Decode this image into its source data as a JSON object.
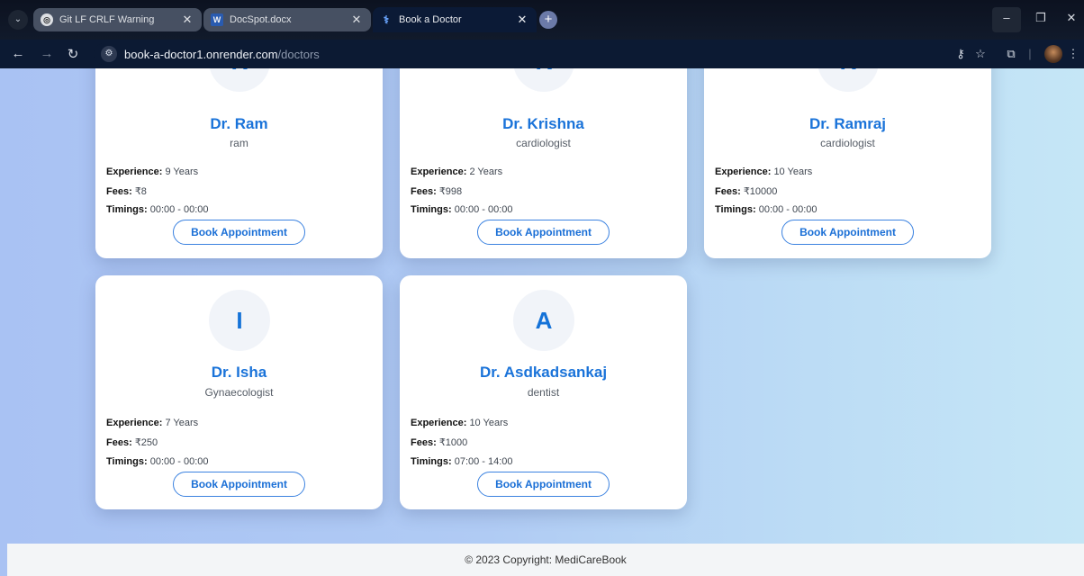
{
  "browser": {
    "tabs": [
      {
        "title": "Git LF CRLF Warning",
        "icon": "chatgpt-icon",
        "active": false
      },
      {
        "title": "DocSpot.docx",
        "icon": "word-icon",
        "active": false
      },
      {
        "title": "Book a Doctor",
        "icon": "stethoscope-icon",
        "active": true
      }
    ],
    "url_host": "book-a-doctor1.onrender.com",
    "url_path": "/doctors"
  },
  "doctors": [
    {
      "initial": "R",
      "name": "Dr. Ram",
      "specialization": "ram",
      "experience_label": "Experience:",
      "experience": "9 Years",
      "fees_label": "Fees:",
      "fees": "₹8",
      "timings_label": "Timings:",
      "timings": "00:00 - 00:00",
      "button": "Book Appointment"
    },
    {
      "initial": "K",
      "name": "Dr. Krishna",
      "specialization": "cardiologist",
      "experience_label": "Experience:",
      "experience": "2 Years",
      "fees_label": "Fees:",
      "fees": "₹998",
      "timings_label": "Timings:",
      "timings": "00:00 - 00:00",
      "button": "Book Appointment"
    },
    {
      "initial": "R",
      "name": "Dr. Ramraj",
      "specialization": "cardiologist",
      "experience_label": "Experience:",
      "experience": "10 Years",
      "fees_label": "Fees:",
      "fees": "₹10000",
      "timings_label": "Timings:",
      "timings": "00:00 - 00:00",
      "button": "Book Appointment"
    },
    {
      "initial": "I",
      "name": "Dr. Isha",
      "specialization": "Gynaecologist",
      "experience_label": "Experience:",
      "experience": "7 Years",
      "fees_label": "Fees:",
      "fees": "₹250",
      "timings_label": "Timings:",
      "timings": "00:00 - 00:00",
      "button": "Book Appointment"
    },
    {
      "initial": "A",
      "name": "Dr. Asdkadsankaj",
      "specialization": "dentist",
      "experience_label": "Experience:",
      "experience": "10 Years",
      "fees_label": "Fees:",
      "fees": "₹1000",
      "timings_label": "Timings:",
      "timings": "07:00 - 14:00",
      "button": "Book Appointment"
    }
  ],
  "footer": {
    "copyright": "© 2023 Copyright: MediCareBook"
  },
  "colors": {
    "accent": "#1a73d9",
    "background": "#b0cbf4",
    "card": "#ffffff"
  }
}
